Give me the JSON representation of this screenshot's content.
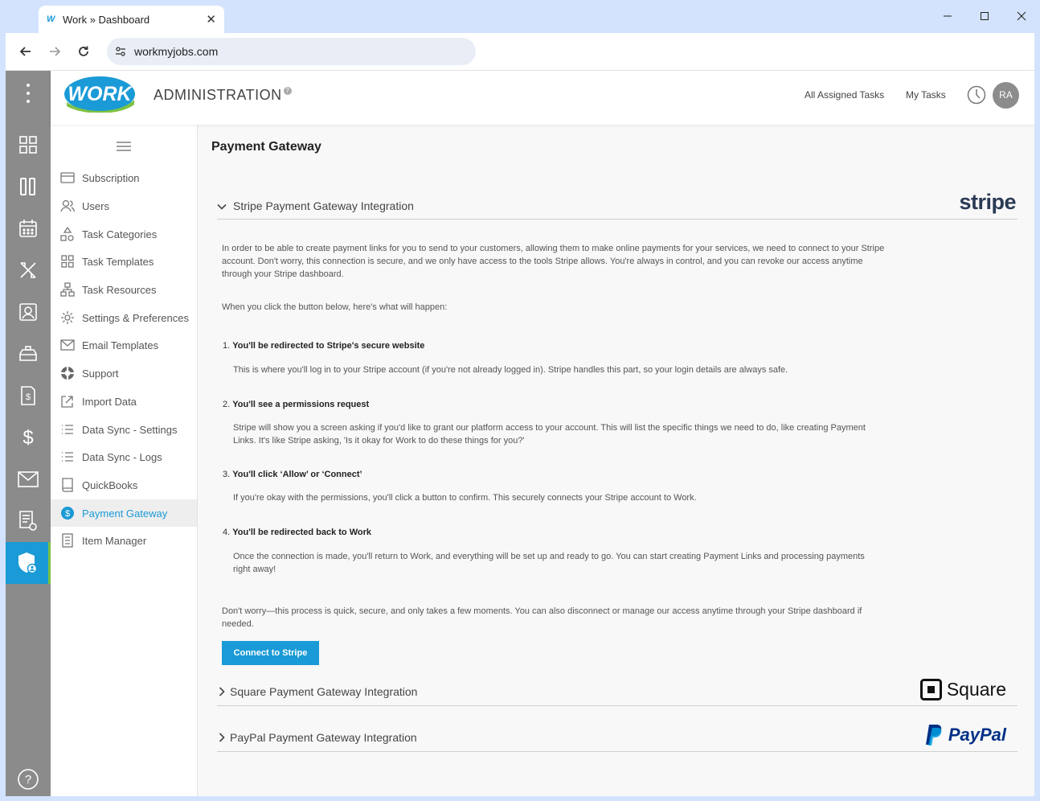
{
  "browser": {
    "tab_title": "Work » Dashboard",
    "tab_favicon": "W",
    "url": "workmyjobs.com"
  },
  "header": {
    "logo_text": "WORK",
    "title": "ADMINISTRATION",
    "help_glyph": "?",
    "links": [
      "All Assigned Tasks",
      "My Tasks"
    ],
    "avatar_initials": "RA"
  },
  "sidebar": {
    "items": [
      {
        "label": "Subscription",
        "icon": "card-icon"
      },
      {
        "label": "Users",
        "icon": "users-icon"
      },
      {
        "label": "Task Categories",
        "icon": "shapes-icon"
      },
      {
        "label": "Task Templates",
        "icon": "grid-icon"
      },
      {
        "label": "Task Resources",
        "icon": "hierarchy-icon"
      },
      {
        "label": "Settings & Preferences",
        "icon": "gear-icon"
      },
      {
        "label": "Email Templates",
        "icon": "envelope-icon"
      },
      {
        "label": "Support",
        "icon": "lifebuoy-icon"
      },
      {
        "label": "Import Data",
        "icon": "import-icon"
      },
      {
        "label": "Data Sync - Settings",
        "icon": "list-icon"
      },
      {
        "label": "Data Sync - Logs",
        "icon": "list-icon"
      },
      {
        "label": "QuickBooks",
        "icon": "book-icon"
      },
      {
        "label": "Payment Gateway",
        "icon": "dollar-circle-icon",
        "active": true
      },
      {
        "label": "Item Manager",
        "icon": "document-icon"
      }
    ]
  },
  "main": {
    "page_title": "Payment Gateway",
    "stripe": {
      "heading": "Stripe Payment Gateway Integration",
      "brand": "stripe",
      "intro": "In order to be able to create payment links for you to send to your customers, allowing them to make online payments for your services, we need to connect to your Stripe account. Don't worry, this connection is secure, and we only have access to the tools Stripe allows. You're always in control, and you can revoke our access anytime through your Stripe dashboard.",
      "lead": "When you click the button below, here's what will happen:",
      "steps": [
        {
          "num": "1.",
          "title": "You'll be redirected to Stripe's secure website",
          "text": "This is where you'll log in to your Stripe account (if you're not already logged in). Stripe handles this part, so your login details are always safe."
        },
        {
          "num": "2.",
          "title": "You'll see a permissions request",
          "text": "Stripe will show you a screen asking if you'd like to grant our platform access to your account. This will list the specific things we need to do, like creating Payment Links. It's like Stripe asking, 'Is it okay for Work to do these things for you?'"
        },
        {
          "num": "3.",
          "title": "You'll click ‘Allow’ or ‘Connect’",
          "text": "If you're okay with the permissions, you'll click a button to confirm. This securely connects your Stripe account to Work."
        },
        {
          "num": "4.",
          "title": "You'll be redirected back to Work",
          "text": "Once the connection is made, you'll return to Work, and everything will be set up and ready to go. You can start creating Payment Links and processing payments right away!"
        }
      ],
      "outro": "Don't worry—this process is quick, secure, and only takes a few moments. You can also disconnect or manage our access anytime through your Stripe dashboard if needed.",
      "button": "Connect to Stripe"
    },
    "square": {
      "heading": "Square Payment Gateway Integration",
      "brand": "Square"
    },
    "paypal": {
      "heading": "PayPal Payment Gateway Integration",
      "brand": "PayPal"
    }
  },
  "colors": {
    "accent": "#1a9ad6",
    "rail": "#8b8b8b",
    "active_marker": "#7cc242"
  }
}
